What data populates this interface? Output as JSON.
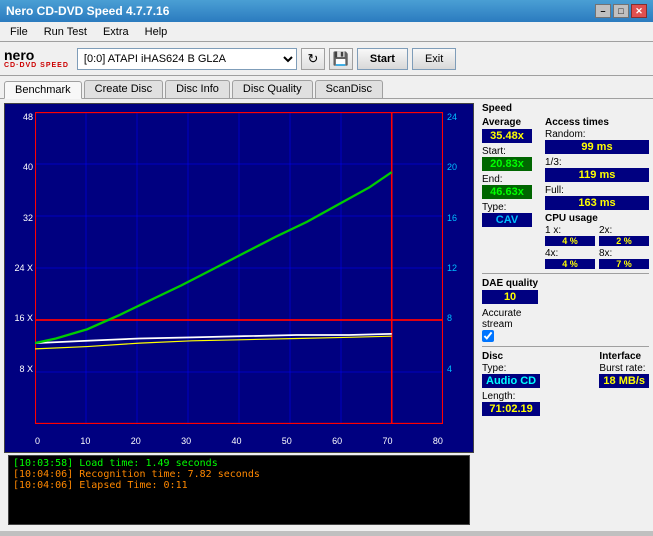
{
  "window": {
    "title": "Nero CD-DVD Speed 4.7.7.16",
    "min_btn": "–",
    "max_btn": "□",
    "close_btn": "✕"
  },
  "menu": {
    "items": [
      "File",
      "Run Test",
      "Extra",
      "Help"
    ]
  },
  "toolbar": {
    "logo_main": "nero",
    "logo_sub": "CD·DVD SPEED",
    "drive": "[0:0]  ATAPI iHAS624  B GL2A",
    "start_label": "Start",
    "exit_label": "Exit"
  },
  "tabs": [
    {
      "label": "Benchmark",
      "active": true
    },
    {
      "label": "Create Disc",
      "active": false
    },
    {
      "label": "Disc Info",
      "active": false
    },
    {
      "label": "Disc Quality",
      "active": false
    },
    {
      "label": "ScanDisc",
      "active": false
    }
  ],
  "chart": {
    "y_left": [
      "48",
      "40",
      "32",
      "24 X",
      "16 X",
      "8 X",
      ""
    ],
    "y_right": [
      "24",
      "20",
      "16",
      "12",
      "8",
      "4",
      ""
    ],
    "x": [
      "0",
      "10",
      "20",
      "30",
      "40",
      "50",
      "60",
      "70",
      "80"
    ]
  },
  "log": [
    {
      "time": "[10:03:58]",
      "text": " Load time: 1.49 seconds",
      "color": "green"
    },
    {
      "time": "[10:04:06]",
      "text": " Recognition time: 7.82 seconds",
      "color": "orange"
    },
    {
      "time": "[10:04:06]",
      "text": " Elapsed Time: 0:11",
      "color": "orange"
    }
  ],
  "right_panel": {
    "speed_label": "Speed",
    "average_label": "Average",
    "average_value": "35.48x",
    "start_label": "Start:",
    "start_value": "20.83x",
    "end_label": "End:",
    "end_value": "46.63x",
    "type_label": "Type:",
    "type_value": "CAV",
    "access_label": "Access times",
    "random_label": "Random:",
    "random_value": "99 ms",
    "one_third_label": "1/3:",
    "one_third_value": "119 ms",
    "full_label": "Full:",
    "full_value": "163 ms",
    "cpu_label": "CPU usage",
    "cpu_1x_label": "1 x:",
    "cpu_1x_value": "4 %",
    "cpu_2x_label": "2x:",
    "cpu_2x_value": "2 %",
    "cpu_4x_label": "4x:",
    "cpu_4x_value": "4 %",
    "cpu_8x_label": "8x:",
    "cpu_8x_value": "7 %",
    "dae_label": "DAE quality",
    "dae_value": "10",
    "accurate_label": "Accurate",
    "stream_label": "stream",
    "disc_label": "Disc",
    "type2_label": "Type:",
    "disc_type_value": "Audio CD",
    "length_label": "Length:",
    "length_value": "71:02.19",
    "interface_label": "Interface",
    "burst_label": "Burst rate:",
    "burst_value": "18 MB/s"
  }
}
